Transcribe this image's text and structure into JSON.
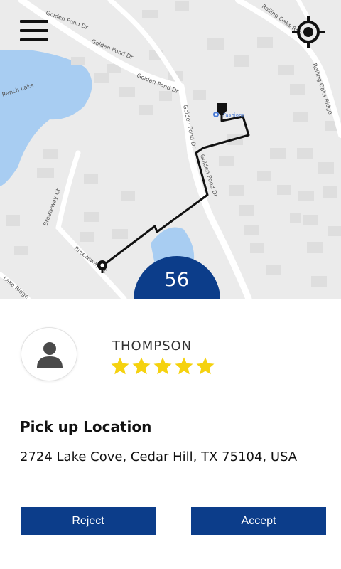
{
  "map": {
    "street_labels": [
      "Golden Pond Dr",
      "Golden Pond Dr",
      "Golden Pond Dr",
      "Golden Pond Dr",
      "Golden Pond Dr",
      "Rolling Oaks Rdg",
      "Rolling Oaks Ridge",
      "Breezeway Ct",
      "Breezeway Ct",
      "Lake Ridge"
    ],
    "water_label": "Ranch Lake",
    "poi_label": "Fashions",
    "eta_value": "56"
  },
  "rider": {
    "name": "THOMPSON",
    "rating": 5,
    "rating_max": 5
  },
  "pickup": {
    "heading": "Pick up Location",
    "address": "2724 Lake Cove, Cedar Hill, TX 75104, USA"
  },
  "actions": {
    "reject_label": "Reject",
    "accept_label": "Accept"
  },
  "colors": {
    "primary": "#0c3d8a",
    "water": "#a8cdf2",
    "star": "#f5d20f",
    "map_background": "#ebebeb"
  }
}
